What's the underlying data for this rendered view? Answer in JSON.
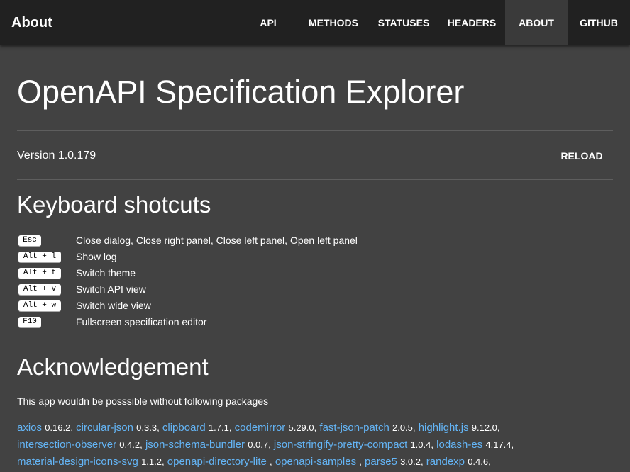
{
  "header": {
    "title": "About",
    "nav": [
      {
        "label": "API"
      },
      {
        "label": "METHODS"
      },
      {
        "label": "STATUSES"
      },
      {
        "label": "HEADERS"
      },
      {
        "label": "ABOUT",
        "active": true
      },
      {
        "label": "GITHUB"
      }
    ]
  },
  "page": {
    "title": "OpenAPI Specification Explorer",
    "version": "Version 1.0.179",
    "reload_label": "RELOAD"
  },
  "shortcuts": {
    "heading": "Keyboard shotcuts",
    "items": [
      {
        "key": "Esc",
        "desc": "Close dialog, Close right panel, Close left panel, Open left panel"
      },
      {
        "key": "Alt + l",
        "desc": "Show log"
      },
      {
        "key": "Alt + t",
        "desc": "Switch theme"
      },
      {
        "key": "Alt + v",
        "desc": "Switch API view"
      },
      {
        "key": "Alt + w",
        "desc": "Switch wide view"
      },
      {
        "key": "F10",
        "desc": "Fullscreen specification editor"
      }
    ]
  },
  "acknowledgement": {
    "heading": "Acknowledgement",
    "intro": "This app wouldn be posssible without following packages",
    "lines": [
      [
        {
          "name": "axios",
          "version": "0.16.2,"
        },
        {
          "name": "circular-json",
          "version": "0.3.3,"
        },
        {
          "name": "clipboard",
          "version": "1.7.1,"
        },
        {
          "name": "codemirror",
          "version": "5.29.0,"
        },
        {
          "name": "fast-json-patch",
          "version": "2.0.5,"
        },
        {
          "name": "highlight.js",
          "version": "9.12.0,"
        }
      ],
      [
        {
          "name": "intersection-observer",
          "version": "0.4.2,"
        },
        {
          "name": "json-schema-bundler",
          "version": "0.0.7,"
        },
        {
          "name": "json-stringify-pretty-compact",
          "version": "1.0.4,"
        },
        {
          "name": "lodash-es",
          "version": "4.17.4,"
        }
      ],
      [
        {
          "name": "material-design-icons-svg",
          "version": "1.1.2,"
        },
        {
          "name": "openapi-directory-lite",
          "version": ","
        },
        {
          "name": "openapi-samples",
          "version": ","
        },
        {
          "name": "parse5",
          "version": "3.0.2,"
        },
        {
          "name": "randexp",
          "version": "0.4.6,"
        }
      ]
    ]
  },
  "colors": {
    "background": "#424242",
    "topbar": "#212121",
    "link": "#64b5f6",
    "text": "#ffffff"
  }
}
